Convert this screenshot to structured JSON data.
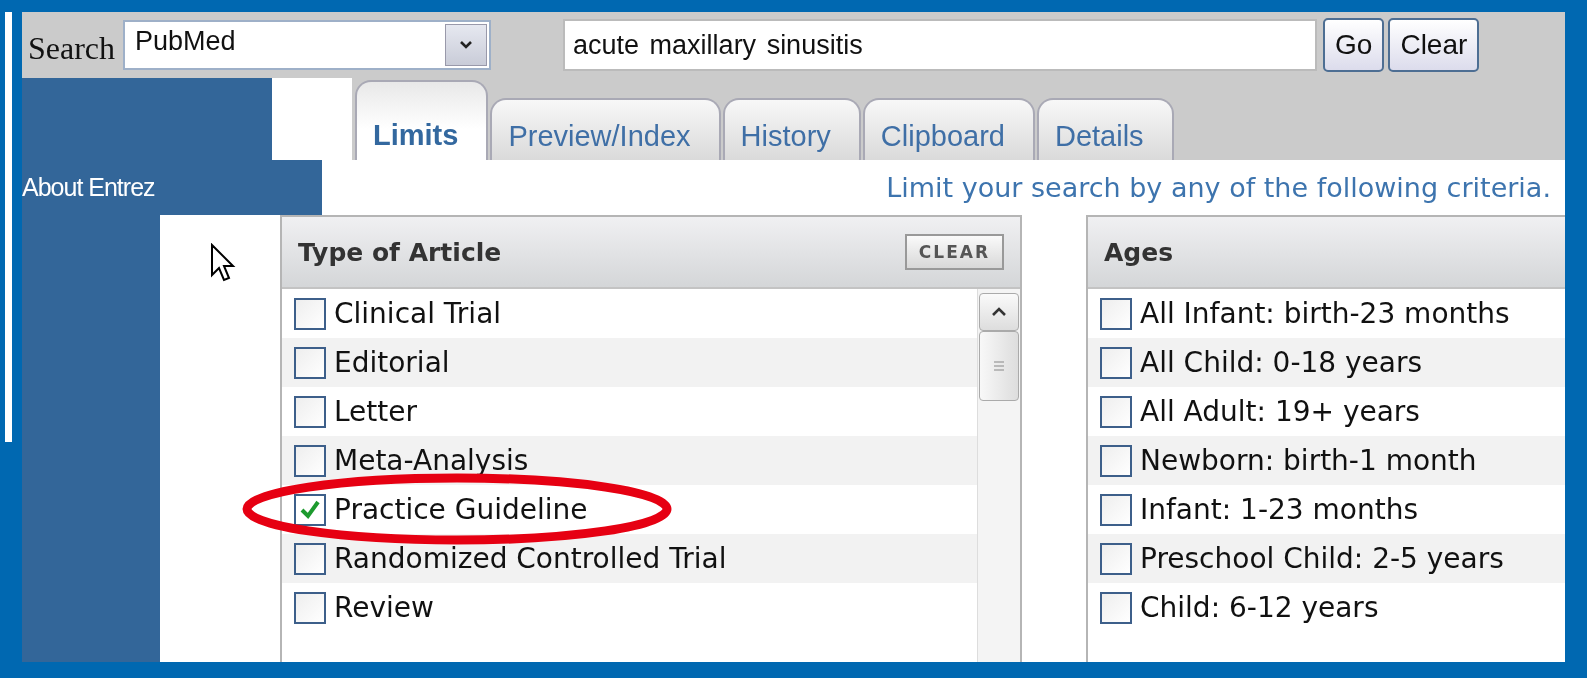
{
  "search": {
    "label": "Search",
    "database": "PubMed",
    "query": "acute maxillary sinusitis",
    "buttons": [
      "Go",
      "Clear"
    ]
  },
  "tabs": [
    {
      "label": "Limits",
      "selected": true
    },
    {
      "label": "Preview/Index",
      "selected": false
    },
    {
      "label": "History",
      "selected": false
    },
    {
      "label": "Clipboard",
      "selected": false
    },
    {
      "label": "Details",
      "selected": false
    }
  ],
  "sidebar": {
    "items": [
      "About Entrez"
    ]
  },
  "hint": "Limit your search by any of the following criteria.",
  "panels": [
    {
      "title": "Type of Article",
      "clear_button": "CLEAR",
      "scrollable": true,
      "options": [
        {
          "label": "Clinical Trial",
          "checked": false,
          "circled": false
        },
        {
          "label": "Editorial",
          "checked": false,
          "circled": false
        },
        {
          "label": "Letter",
          "checked": false,
          "circled": false
        },
        {
          "label": "Meta-Analysis",
          "checked": false,
          "circled": false
        },
        {
          "label": "Practice Guideline",
          "checked": true,
          "circled": true
        },
        {
          "label": "Randomized Controlled Trial",
          "checked": false,
          "circled": false
        },
        {
          "label": "Review",
          "checked": false,
          "circled": false
        }
      ]
    },
    {
      "title": "Ages",
      "scrollable": false,
      "options": [
        {
          "label": "All Infant: birth-23 months",
          "checked": false,
          "circled": false
        },
        {
          "label": "All Child: 0-18 years",
          "checked": false,
          "circled": false
        },
        {
          "label": "All Adult: 19+ years",
          "checked": false,
          "circled": false
        },
        {
          "label": "Newborn: birth-1 month",
          "checked": false,
          "circled": false
        },
        {
          "label": "Infant: 1-23 months",
          "checked": false,
          "circled": false
        },
        {
          "label": "Preschool Child: 2-5 years",
          "checked": false,
          "circled": false
        },
        {
          "label": "Child: 6-12 years",
          "checked": false,
          "circled": false
        }
      ]
    }
  ]
}
